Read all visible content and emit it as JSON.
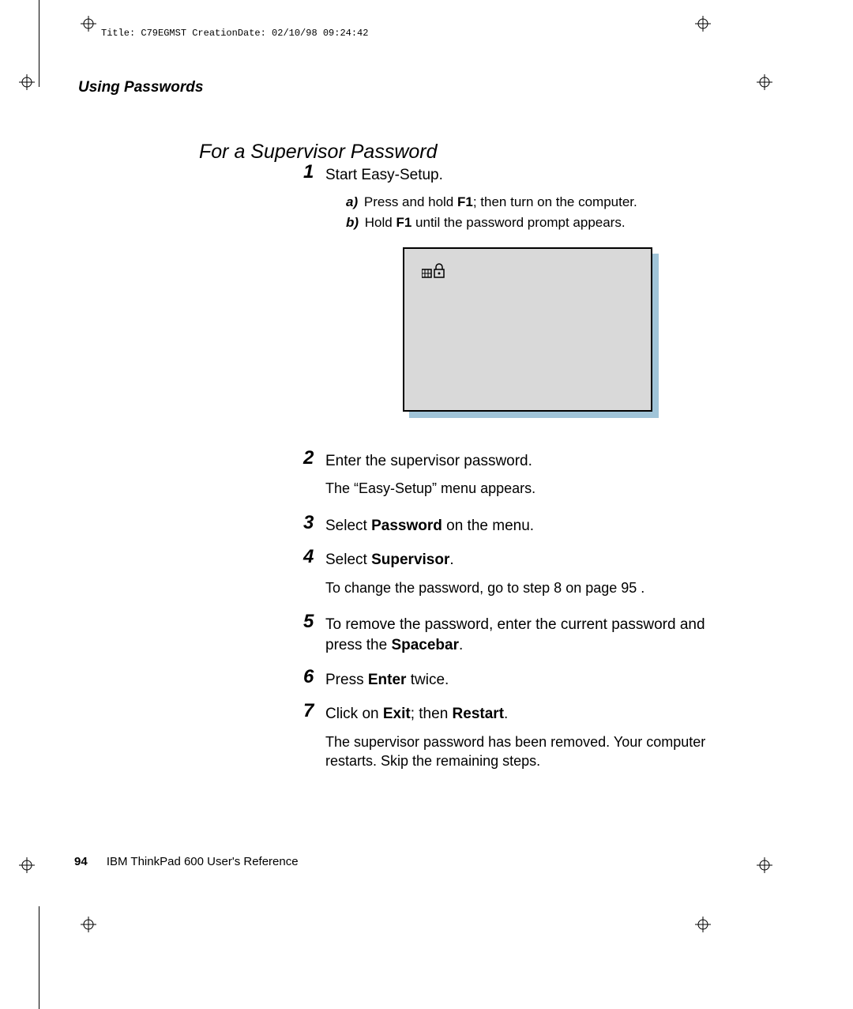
{
  "meta": {
    "header_line": "Title: C79EGMST CreationDate: 02/10/98 09:24:42"
  },
  "section_header": "Using Passwords",
  "subsection_title": "For a Supervisor Password",
  "steps": {
    "s1": {
      "num": "1",
      "text": "Start Easy-Setup.",
      "sub_a_label": "a)",
      "sub_a_pre": "Press and hold ",
      "sub_a_bold": "F1",
      "sub_a_post": "; then turn on the computer.",
      "sub_b_label": "b)",
      "sub_b_pre": "Hold ",
      "sub_b_bold": "F1",
      "sub_b_post": " until the password prompt appears."
    },
    "s2": {
      "num": "2",
      "text": "Enter the supervisor password.",
      "note": "The “Easy-Setup” menu appears."
    },
    "s3": {
      "num": "3",
      "pre": "Select ",
      "bold": "Password",
      "post": " on the menu."
    },
    "s4": {
      "num": "4",
      "pre": "Select ",
      "bold": "Supervisor",
      "post": ".",
      "note": "To change the password, go to step 8 on page  95 ."
    },
    "s5": {
      "num": "5",
      "pre": "To remove the password, enter the current password and press the ",
      "bold": "Spacebar",
      "post": "."
    },
    "s6": {
      "num": "6",
      "pre": "Press ",
      "bold": "Enter",
      "post": " twice."
    },
    "s7": {
      "num": "7",
      "pre": "Click on ",
      "bold1": "Exit",
      "mid": "; then ",
      "bold2": "Restart",
      "post": ".",
      "note": "The supervisor password has been removed.  Your computer restarts.  Skip the remaining steps."
    }
  },
  "footer": {
    "page": "94",
    "book": "IBM ThinkPad 600 User's Reference"
  }
}
